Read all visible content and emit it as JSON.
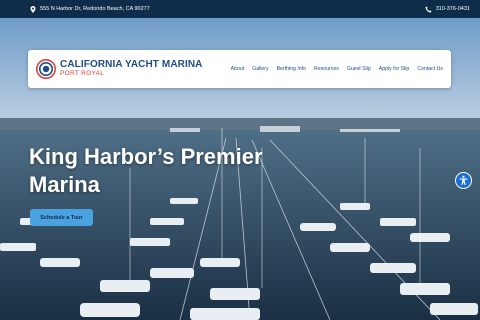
{
  "topbar": {
    "address": "555 N Harbor Dr, Redondo Beach, CA 90277",
    "phone": "310-376-0431",
    "icons": [
      "map-pin-icon",
      "phone-icon"
    ]
  },
  "header": {
    "brand_title": "CALIFORNIA YACHT MARINA",
    "brand_subtitle": "PORT ROYAL",
    "nav": [
      {
        "label": "About"
      },
      {
        "label": "Gallery"
      },
      {
        "label": "Berthing Info"
      },
      {
        "label": "Resources"
      },
      {
        "label": "Guest Slip"
      },
      {
        "label": "Apply for Slip"
      },
      {
        "label": "Contact Us"
      }
    ]
  },
  "hero": {
    "headline": "King Harbor’s Premier Marina",
    "cta_label": "Schedule a Tour"
  },
  "colors": {
    "topbar_bg": "#0e2d4b",
    "brand_blue": "#1e4d87",
    "brand_red": "#d8463c",
    "cta_bg": "#4aa3e0",
    "accessibility_blue": "#1b6fd4"
  }
}
